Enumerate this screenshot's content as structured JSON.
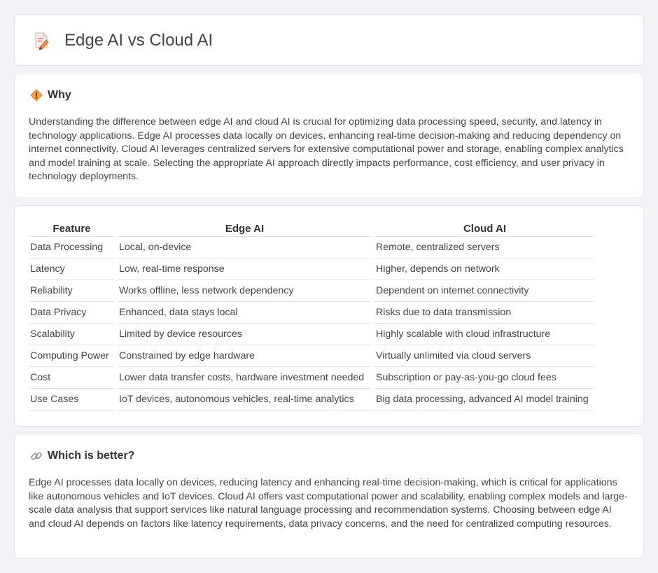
{
  "header": {
    "title": "Edge AI vs Cloud AI",
    "icon": "document-pencil-icon"
  },
  "why": {
    "icon": "warning-diamond-icon",
    "title": "Why",
    "body": "Understanding the difference between edge AI and cloud AI is crucial for optimizing data processing speed, security, and latency in technology applications. Edge AI processes data locally on devices, enhancing real-time decision-making and reducing dependency on internet connectivity. Cloud AI leverages centralized servers for extensive computational power and storage, enabling complex analytics and model training at scale. Selecting the appropriate AI approach directly impacts performance, cost efficiency, and user privacy in technology deployments."
  },
  "comparison": {
    "headers": [
      "Feature",
      "Edge AI",
      "Cloud AI"
    ],
    "rows": [
      [
        "Data Processing",
        "Local, on-device",
        "Remote, centralized servers"
      ],
      [
        "Latency",
        "Low, real-time response",
        "Higher, depends on network"
      ],
      [
        "Reliability",
        "Works offline, less network dependency",
        "Dependent on internet connectivity"
      ],
      [
        "Data Privacy",
        "Enhanced, data stays local",
        "Risks due to data transmission"
      ],
      [
        "Scalability",
        "Limited by device resources",
        "Highly scalable with cloud infrastructure"
      ],
      [
        "Computing Power",
        "Constrained by edge hardware",
        "Virtually unlimited via cloud servers"
      ],
      [
        "Cost",
        "Lower data transfer costs, hardware investment needed",
        "Subscription or pay-as-you-go cloud fees"
      ],
      [
        "Use Cases",
        "IoT devices, autonomous vehicles, real-time analytics",
        "Big data processing, advanced AI model training"
      ]
    ]
  },
  "better": {
    "icon": "link-icon",
    "title": "Which is better?",
    "body": "Edge AI processes data locally on devices, reducing latency and enhancing real-time decision-making, which is critical for applications like autonomous vehicles and IoT devices. Cloud AI offers vast computational power and scalability, enabling complex models and large-scale data analysis that support services like natural language processing and recommendation systems. Choosing between edge AI and cloud AI depends on factors like latency requirements, data privacy concerns, and the need for centralized computing resources."
  },
  "colors": {
    "background": "#f3f4f8",
    "card": "#ffffff",
    "accent": "#f0a030"
  }
}
